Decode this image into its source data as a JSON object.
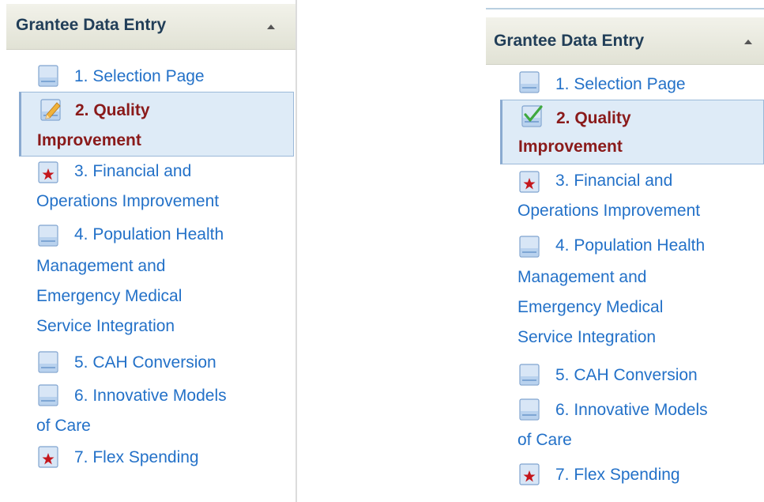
{
  "panels": [
    {
      "header": {
        "title": "Grantee Data Entry"
      },
      "items": [
        {
          "line1": "1. Selection Page",
          "line2": "",
          "icon": "page-icon"
        },
        {
          "line1": "2. Quality",
          "line2": "Improvement",
          "icon": "pencil-page-icon"
        },
        {
          "line1": "3. Financial and",
          "line2": "Operations Improvement",
          "icon": "star-page-icon"
        },
        {
          "line1": "4. Population Health",
          "line2": "Management and",
          "line3": "Emergency Medical",
          "line4": "Service Integration",
          "icon": "page-icon"
        },
        {
          "line1": "5. CAH Conversion",
          "line2": "",
          "icon": "page-icon"
        },
        {
          "line1": "6. Innovative Models",
          "line2": "of Care",
          "icon": "page-icon"
        },
        {
          "line1": "7. Flex Spending",
          "line2": "",
          "icon": "star-page-icon"
        }
      ],
      "selected_index": 1
    },
    {
      "header": {
        "title": "Grantee Data Entry"
      },
      "items": [
        {
          "line1": "1. Selection Page",
          "line2": "",
          "icon": "page-icon"
        },
        {
          "line1": "2. Quality",
          "line2": "Improvement",
          "icon": "check-page-icon"
        },
        {
          "line1": "3. Financial and",
          "line2": "Operations Improvement",
          "icon": "star-page-icon"
        },
        {
          "line1": "4. Population Health",
          "line2": "Management and",
          "line3": "Emergency Medical",
          "line4": "Service Integration",
          "icon": "page-icon"
        },
        {
          "line1": "5. CAH Conversion",
          "line2": "",
          "icon": "page-icon"
        },
        {
          "line1": "6. Innovative Models",
          "line2": "of Care",
          "icon": "page-icon"
        },
        {
          "line1": "7. Flex Spending",
          "line2": "",
          "icon": "star-page-icon"
        }
      ],
      "selected_index": 1
    }
  ],
  "colors": {
    "link": "#2371c8",
    "selected_text": "#8a1a1a",
    "selected_bg": "#deebf7",
    "header_text": "#213e58"
  }
}
